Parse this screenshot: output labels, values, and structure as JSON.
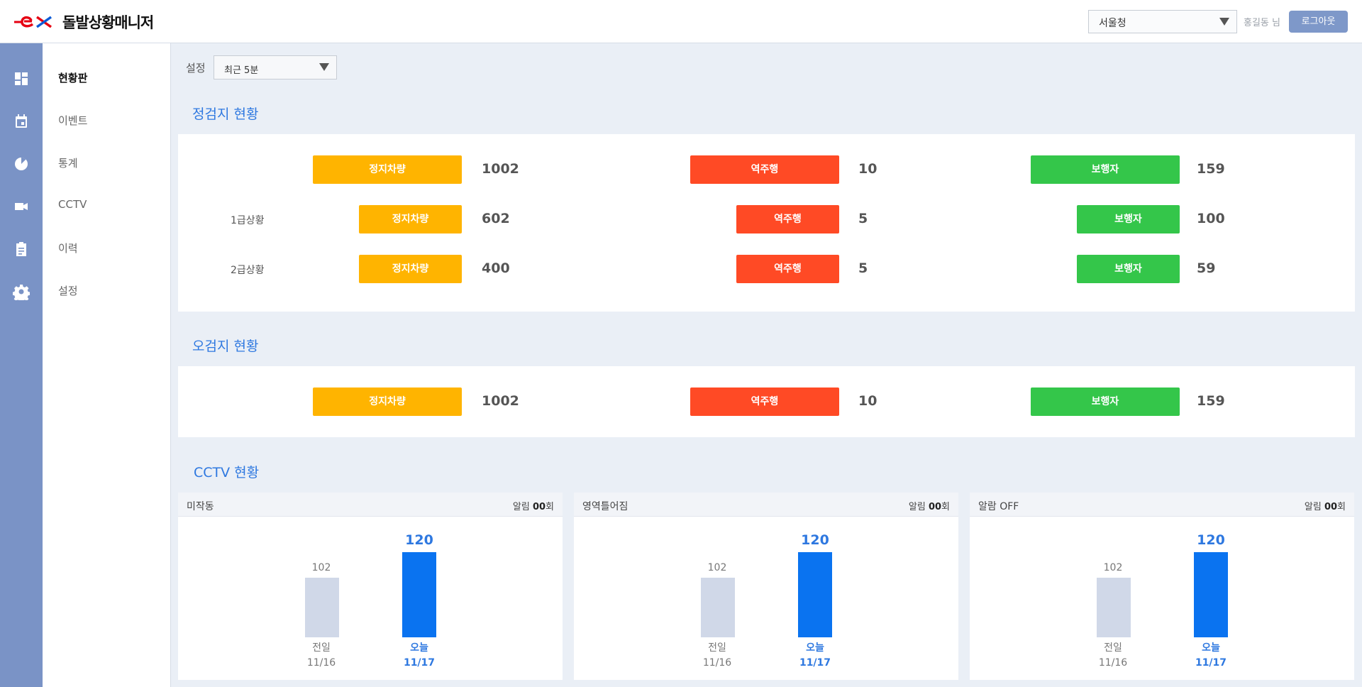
{
  "header": {
    "app_title": "돌발상황매니저",
    "region_select": "서울청",
    "user_name": "홍길동 님",
    "logout_label": "로그아웃",
    "logo_colors": {
      "primary": "#e60012",
      "accent": "#0d5bd6"
    }
  },
  "icon_rail": [
    "dashboard-icon",
    "calendar-icon",
    "pie-chart-icon",
    "video-camera-icon",
    "clipboard-icon",
    "gear-icon"
  ],
  "menu": [
    {
      "label": "현황판",
      "active": true
    },
    {
      "label": "이벤트",
      "active": false
    },
    {
      "label": "통계",
      "active": false
    },
    {
      "label": "CCTV",
      "active": false
    },
    {
      "label": "이력",
      "active": false
    },
    {
      "label": "설정",
      "active": false
    }
  ],
  "filter": {
    "label": "설정",
    "period": "최근 5분"
  },
  "detection": {
    "title": "정검지 현황",
    "total": {
      "stopped_label": "정지차량",
      "stopped": "1002",
      "wrongway_label": "역주행",
      "wrongway": "10",
      "pedestrian_label": "보행자",
      "pedestrian": "159"
    },
    "level1": {
      "label": "1급상황",
      "stopped_label": "정지차량",
      "stopped": "602",
      "wrongway_label": "역주행",
      "wrongway": "5",
      "pedestrian_label": "보행자",
      "pedestrian": "100"
    },
    "level2": {
      "label": "2급상황",
      "stopped_label": "정지차량",
      "stopped": "400",
      "wrongway_label": "역주행",
      "wrongway": "5",
      "pedestrian_label": "보행자",
      "pedestrian": "59"
    }
  },
  "false_detection": {
    "title": "오검지 현황",
    "stopped_label": "정지차량",
    "stopped": "1002",
    "wrongway_label": "역주행",
    "wrongway": "10",
    "pedestrian_label": "보행자",
    "pedestrian": "159"
  },
  "cctv": {
    "title": "CCTV 현황",
    "cards": [
      {
        "title": "미작동",
        "alarm_prefix": "알림 ",
        "alarm_count": "00",
        "alarm_suffix": "회",
        "prev_value": "102",
        "prev_label": "전일",
        "prev_date": "11/16",
        "today_value": "120",
        "today_label": "오늘",
        "today_date": "11/17"
      },
      {
        "title": "영역틀어짐",
        "alarm_prefix": "알림 ",
        "alarm_count": "00",
        "alarm_suffix": "회",
        "prev_value": "102",
        "prev_label": "전일",
        "prev_date": "11/16",
        "today_value": "120",
        "today_label": "오늘",
        "today_date": "11/17"
      },
      {
        "title": "알람 OFF",
        "alarm_prefix": "알림 ",
        "alarm_count": "00",
        "alarm_suffix": "회",
        "prev_value": "102",
        "prev_label": "전일",
        "prev_date": "11/16",
        "today_value": "120",
        "today_label": "오늘",
        "today_date": "11/17"
      }
    ]
  },
  "colors": {
    "stopped": "#ffb400",
    "wrongway": "#ff4a25",
    "pedestrian": "#34c64a",
    "accent": "#2e78e0",
    "bar_today": "#0a73f0",
    "bar_prev": "#d0d8e8",
    "rail": "#7a93c6"
  }
}
